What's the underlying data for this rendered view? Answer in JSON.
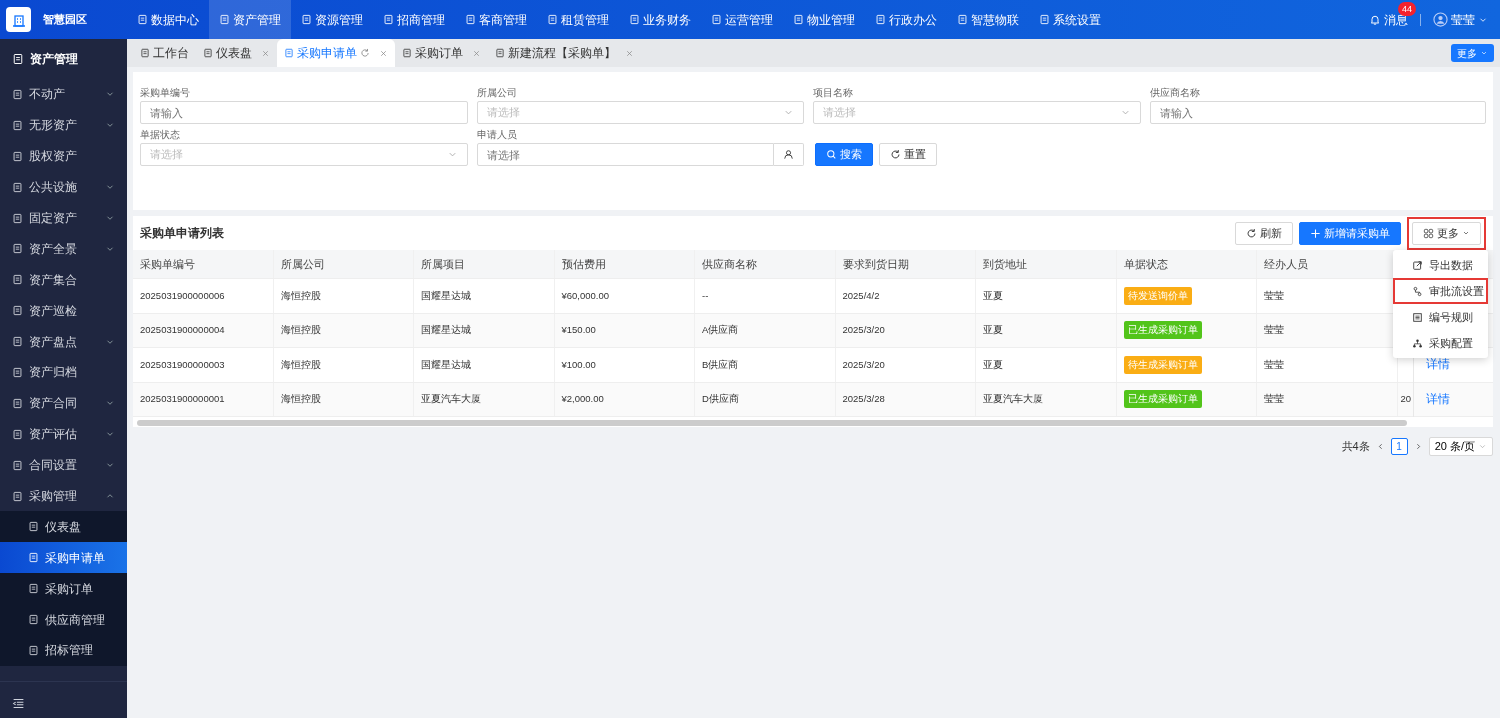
{
  "app": {
    "name": "智慧园区"
  },
  "top_nav": [
    {
      "label": "数据中心",
      "selected": false
    },
    {
      "label": "资产管理",
      "selected": true
    },
    {
      "label": "资源管理",
      "selected": false
    },
    {
      "label": "招商管理",
      "selected": false
    },
    {
      "label": "客商管理",
      "selected": false
    },
    {
      "label": "租赁管理",
      "selected": false
    },
    {
      "label": "业务财务",
      "selected": false
    },
    {
      "label": "运营管理",
      "selected": false
    },
    {
      "label": "物业管理",
      "selected": false
    },
    {
      "label": "行政办公",
      "selected": false
    },
    {
      "label": "智慧物联",
      "selected": false
    },
    {
      "label": "系统设置",
      "selected": false
    }
  ],
  "header_right": {
    "messages": "消息",
    "badge": "44",
    "user": "莹莹"
  },
  "sidebar": {
    "title": "资产管理",
    "items": [
      {
        "label": "不动产",
        "expanded": false
      },
      {
        "label": "无形资产",
        "expanded": false
      },
      {
        "label": "股权资产"
      },
      {
        "label": "公共设施",
        "expanded": false
      },
      {
        "label": "固定资产",
        "expanded": false
      },
      {
        "label": "资产全景",
        "expanded": false
      },
      {
        "label": "资产集合"
      },
      {
        "label": "资产巡检"
      },
      {
        "label": "资产盘点",
        "expanded": false
      },
      {
        "label": "资产归档"
      },
      {
        "label": "资产合同",
        "expanded": false
      },
      {
        "label": "资产评估",
        "expanded": false
      },
      {
        "label": "合同设置",
        "expanded": false
      },
      {
        "label": "采购管理",
        "expanded": true,
        "children": [
          {
            "label": "仪表盘",
            "selected": false
          },
          {
            "label": "采购申请单",
            "selected": true
          },
          {
            "label": "采购订单",
            "selected": false
          },
          {
            "label": "供应商管理",
            "selected": false
          },
          {
            "label": "招标管理",
            "selected": false
          }
        ]
      }
    ]
  },
  "tabs": [
    {
      "label": "工作台",
      "selected": false,
      "closable": false
    },
    {
      "label": "仪表盘",
      "selected": false,
      "closable": true
    },
    {
      "label": "采购申请单",
      "selected": true,
      "closable": true
    },
    {
      "label": "采购订单",
      "selected": false,
      "closable": true
    },
    {
      "label": "新建流程【采购单】",
      "selected": false,
      "closable": true
    }
  ],
  "tabs_more": "更多",
  "filters": [
    {
      "label": "采购单编号",
      "placeholder": "请输入",
      "kind": "input"
    },
    {
      "label": "所属公司",
      "placeholder": "请选择",
      "kind": "select"
    },
    {
      "label": "项目名称",
      "placeholder": "请选择",
      "kind": "select"
    },
    {
      "label": "供应商名称",
      "placeholder": "请输入",
      "kind": "input"
    },
    {
      "label": "单据状态",
      "placeholder": "请选择",
      "kind": "select"
    },
    {
      "label": "申请人员",
      "placeholder": "请选择",
      "kind": "picker"
    }
  ],
  "filter_buttons": [
    {
      "label": "搜索",
      "kind": "primary"
    },
    {
      "label": "重置",
      "kind": "default"
    }
  ],
  "table": {
    "title": "采购单申请列表",
    "buttons": [
      {
        "label": "刷新",
        "kind": "refresh"
      },
      {
        "label": "新增请采购单",
        "kind": "add"
      },
      {
        "label": "更多",
        "kind": "more",
        "highlighted": true
      }
    ],
    "columns": [
      "采购单编号",
      "所属公司",
      "所属项目",
      "预估费用",
      "供应商名称",
      "要求到货日期",
      "到货地址",
      "单据状态",
      "经办人员"
    ],
    "rows": [
      {
        "cells": [
          "2025031900000006",
          "海恒控股",
          "国耀星达城",
          "¥60,000.00",
          "--",
          "2025/4/2",
          "亚夏"
        ],
        "status": {
          "text": "待发送询价单",
          "color": "#faad14"
        },
        "handler": "莹莹"
      },
      {
        "cells": [
          "2025031900000004",
          "海恒控股",
          "国耀星达城",
          "¥150.00",
          "A供应商",
          "2025/3/20",
          "亚夏"
        ],
        "status": {
          "text": "已生成采购订单",
          "color": "#52c41a"
        },
        "handler": "莹莹"
      },
      {
        "cells": [
          "2025031900000003",
          "海恒控股",
          "国耀星达城",
          "¥100.00",
          "B供应商",
          "2025/3/20",
          "亚夏"
        ],
        "status": {
          "text": "待生成采购订单",
          "color": "#faad14"
        },
        "handler": "莹莹",
        "action": "详情"
      },
      {
        "cells": [
          "2025031900000001",
          "海恒控股",
          "亚夏汽车大厦",
          "¥2,000.00",
          "D供应商",
          "2025/3/28",
          "亚夏汽车大厦"
        ],
        "status": {
          "text": "已生成采购订单",
          "color": "#52c41a"
        },
        "handler": "莹莹",
        "column_10": "20",
        "action": "详情"
      }
    ]
  },
  "more_menu": [
    {
      "label": "导出数据",
      "kind": "export",
      "highlighted": false
    },
    {
      "label": "审批流设置",
      "kind": "flow",
      "highlighted": true
    },
    {
      "label": "编号规则",
      "kind": "list",
      "highlighted": false
    },
    {
      "label": "采购配置",
      "kind": "org",
      "highlighted": false
    }
  ],
  "pagination": {
    "total": "共4条",
    "page": "1",
    "page_size": "20 条/页"
  }
}
